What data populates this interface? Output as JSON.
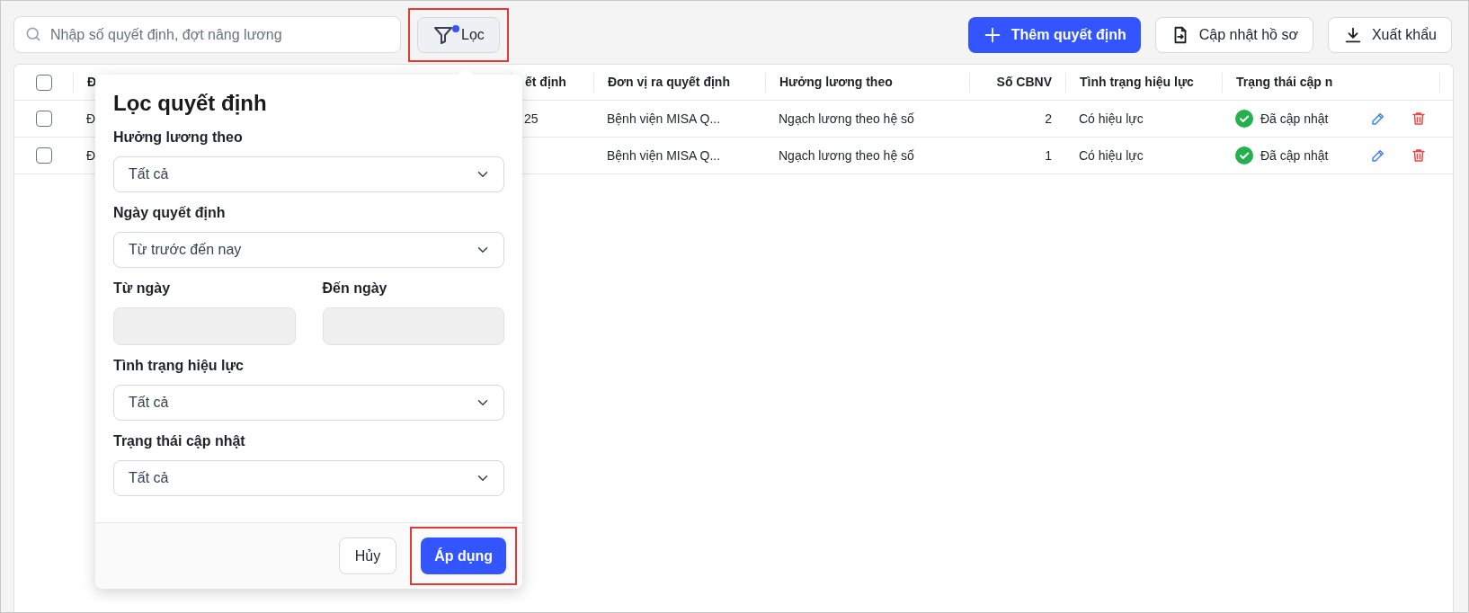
{
  "toolbar": {
    "search": {
      "placeholder": "Nhập số quyết định, đợt nâng lương"
    },
    "filter_button": {
      "label": "Lọc",
      "active_filter": true,
      "highlighted": true
    },
    "actions": [
      {
        "kind": "add",
        "label": "Thêm quyết định"
      },
      {
        "kind": "update",
        "label": "Cập nhật hồ sơ"
      },
      {
        "kind": "export",
        "label": "Xuất khẩu"
      }
    ]
  },
  "table": {
    "select_all_checked": false,
    "columns": [
      {
        "label": "Đ",
        "kind": "text"
      },
      {
        "label": "ết định",
        "kind": "text"
      },
      {
        "label": "Đơn vị ra quyết định",
        "kind": "text"
      },
      {
        "label": "Hưởng lương theo",
        "kind": "text"
      },
      {
        "label": "Số CBNV",
        "kind": "number"
      },
      {
        "label": "Tình trạng hiệu lực",
        "kind": "text"
      },
      {
        "label": "Trạng thái cập n",
        "kind": "status"
      }
    ],
    "rows": [
      {
        "selected": false,
        "cells": [
          "Đ",
          "25",
          "Bệnh viện MISA Q...",
          "Ngạch lương theo hệ số",
          "2",
          "Có hiệu lực",
          "Đã cập nhật"
        ]
      },
      {
        "selected": false,
        "cells": [
          "Đ",
          null,
          "Bệnh viện MISA Q...",
          "Ngạch lương theo hệ số",
          "1",
          "Có hiệu lực",
          "Đã cập nhật"
        ]
      }
    ]
  },
  "filter_popup": {
    "title": "Lọc quyết định",
    "fields": [
      {
        "kind": "select",
        "label": "Hưởng lương theo",
        "value": "Tất cả"
      },
      {
        "kind": "select",
        "label": "Ngày quyết định",
        "value": "Từ trước đến nay"
      },
      {
        "kind": "date_range",
        "from": {
          "label": "Từ ngày",
          "disabled": true
        },
        "to": {
          "label": "Đến ngày",
          "disabled": true
        }
      },
      {
        "kind": "select",
        "label": "Tình trạng hiệu lực",
        "value": "Tất cả"
      },
      {
        "kind": "select",
        "label": "Trạng thái cập nhật",
        "value": "Tất cả"
      }
    ],
    "cancel_button": {
      "label": "Hủy"
    },
    "apply_button": {
      "label": "Áp dụng",
      "highlighted": true
    }
  }
}
